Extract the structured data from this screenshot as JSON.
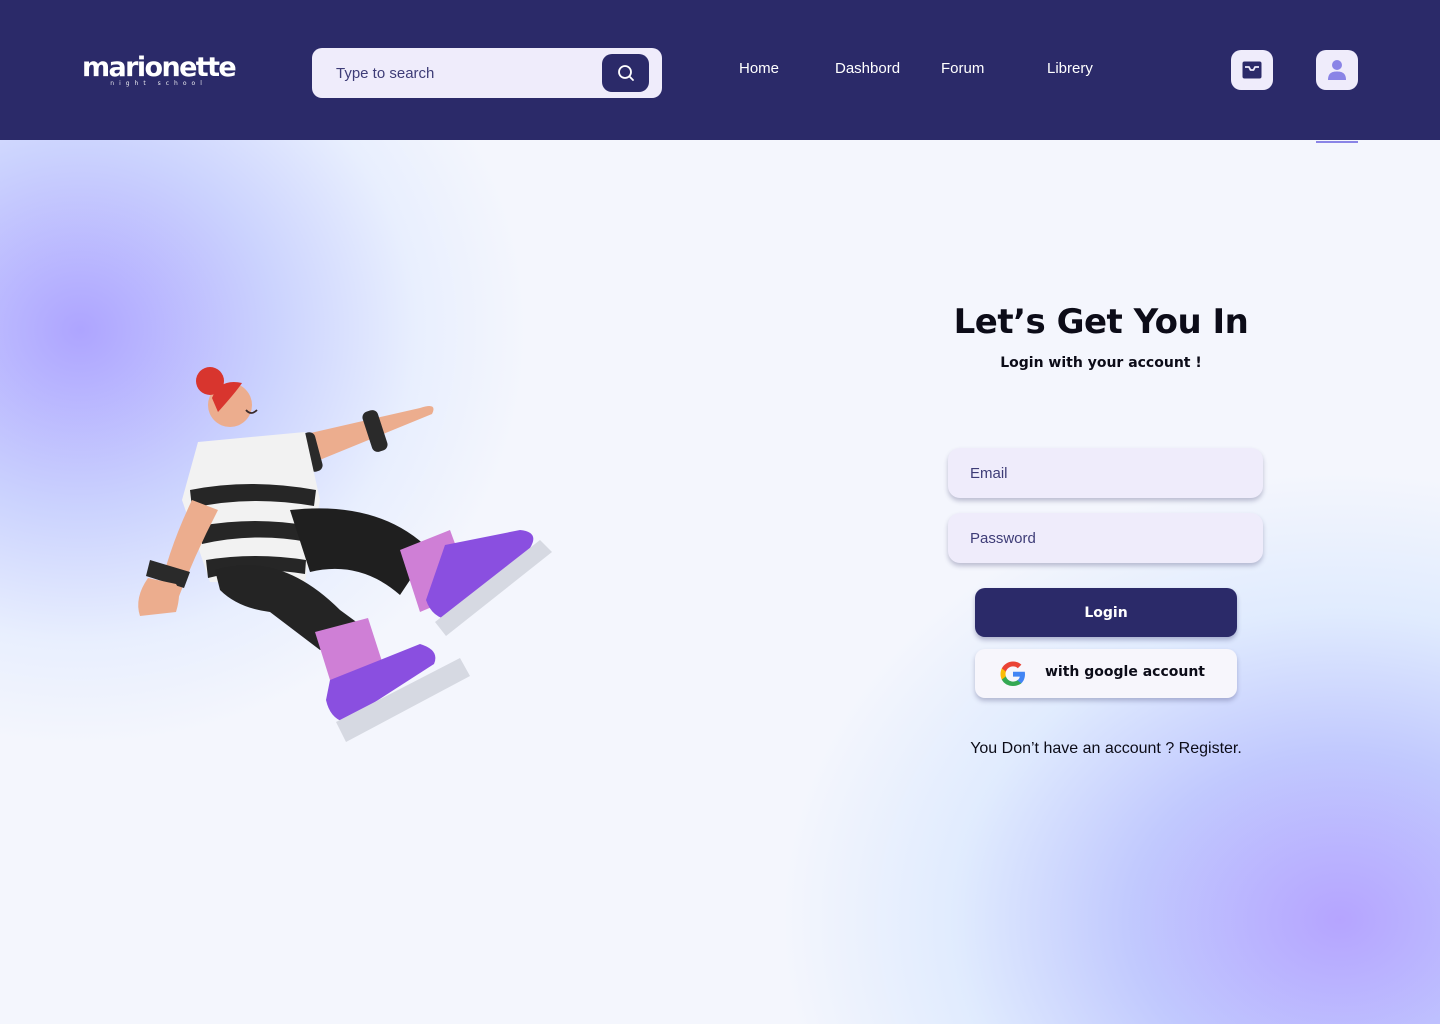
{
  "header": {
    "logo": {
      "name": "marionette",
      "tagline": "night school"
    },
    "search": {
      "placeholder": "Type to search",
      "value": ""
    },
    "nav": [
      {
        "label": "Home"
      },
      {
        "label": "Dashbord"
      },
      {
        "label": "Forum"
      },
      {
        "label": "Librery"
      }
    ],
    "icons": {
      "inbox": "inbox-icon",
      "profile": "user-icon",
      "search": "search-icon"
    }
  },
  "login": {
    "title": "Let’s Get You In",
    "subtitle": "Login with your account !",
    "email": {
      "placeholder": "Email",
      "value": ""
    },
    "password": {
      "placeholder": "Password",
      "value": ""
    },
    "submit_label": "Login",
    "google_label": "with google account",
    "register": {
      "prompt": "You Don’t have an account ? ",
      "link": "Register."
    }
  },
  "colors": {
    "primary": "#2b2a69",
    "field_bg": "#efecfb",
    "accent": "#8a84e6",
    "text": "#0c0c18"
  }
}
